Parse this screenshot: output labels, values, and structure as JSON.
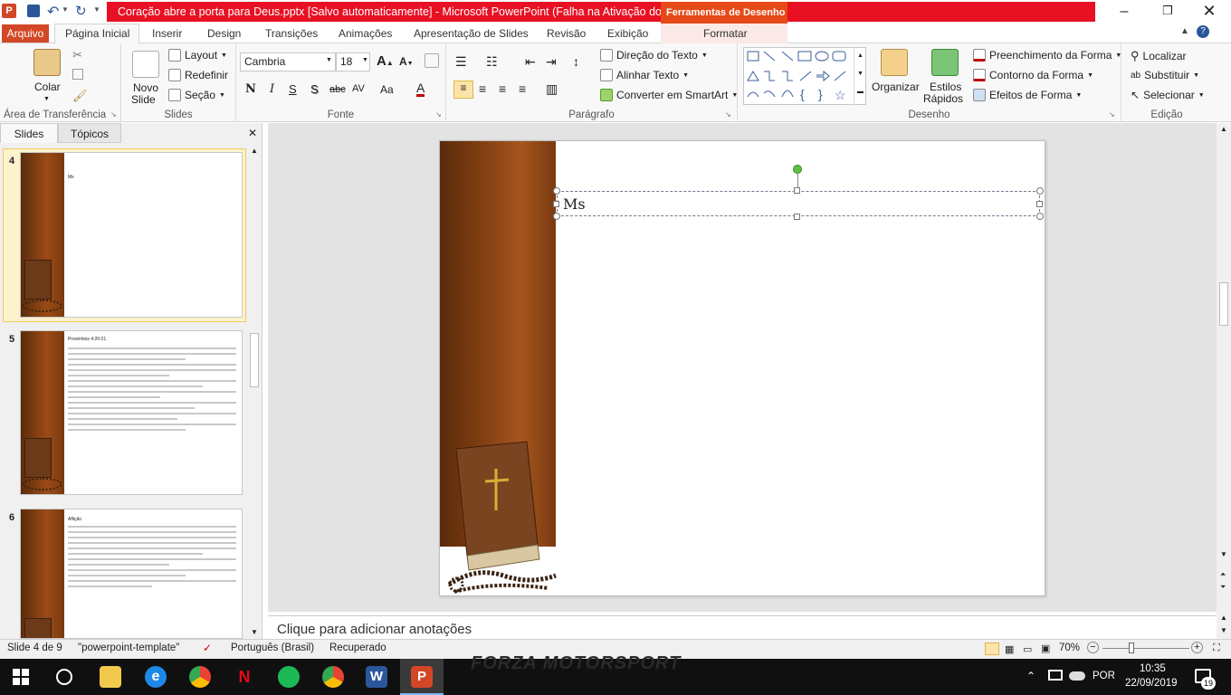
{
  "window": {
    "title": "Coração abre a porta para Deus.pptx [Salvo automaticamente]  -  Microsoft PowerPoint (Falha na Ativação do ...",
    "contextual_tool": "Ferramentas de Desenho",
    "contextual_tab": "Formatar"
  },
  "tabs": {
    "file": "Arquivo",
    "items": [
      "Página Inicial",
      "Inserir",
      "Design",
      "Transições",
      "Animações",
      "Apresentação de Slides",
      "Revisão",
      "Exibição"
    ]
  },
  "ribbon": {
    "clipboard": {
      "paste": "Colar",
      "label": "Área de Transferência"
    },
    "slides": {
      "new_slide": "Novo",
      "new_slide2": "Slide",
      "layout": "Layout",
      "reset": "Redefinir",
      "section": "Seção",
      "label": "Slides"
    },
    "font": {
      "name": "Cambria",
      "size": "18",
      "bold": "N",
      "italic": "I",
      "underline": "S",
      "shadow": "S",
      "strike": "abc",
      "spacing": "AV",
      "case": "Aa",
      "color": "A",
      "label": "Fonte"
    },
    "paragraph": {
      "text_direction": "Direção do Texto",
      "align_text": "Alinhar Texto",
      "smartart": "Converter em SmartArt",
      "label": "Parágrafo"
    },
    "drawing": {
      "arrange": "Organizar",
      "quick_styles": "Estilos",
      "quick_styles2": "Rápidos",
      "fill": "Preenchimento da Forma",
      "outline": "Contorno da Forma",
      "effects": "Efeitos de Forma",
      "label": "Desenho"
    },
    "editing": {
      "find": "Localizar",
      "replace": "Substituir",
      "select": "Selecionar",
      "label": "Edição"
    }
  },
  "left_pane": {
    "tab_slides": "Slides",
    "tab_outline": "Tópicos",
    "slides": [
      {
        "num": "4",
        "title": "Ms"
      },
      {
        "num": "5",
        "title": "Provérbios 4:20-21"
      },
      {
        "num": "6",
        "title": "Aflição"
      }
    ]
  },
  "slide": {
    "title_text": "Ms"
  },
  "notes": {
    "placeholder": "Clique para adicionar anotações"
  },
  "status": {
    "slide_of": "Slide 4 de 9",
    "theme": "\"powerpoint-template\"",
    "language": "Português (Brasil)",
    "recovered": "Recuperado",
    "zoom": "70%"
  },
  "taskbar": {
    "language": "POR",
    "time": "10:35",
    "date": "22/09/2019",
    "notifications": "19",
    "background_text": "FORZA MOTORSPORT"
  },
  "colors": {
    "title_red": "#e81123",
    "file_tab": "#d24726",
    "contextual": "#e64a19",
    "slide_brown": "#8a4414"
  }
}
